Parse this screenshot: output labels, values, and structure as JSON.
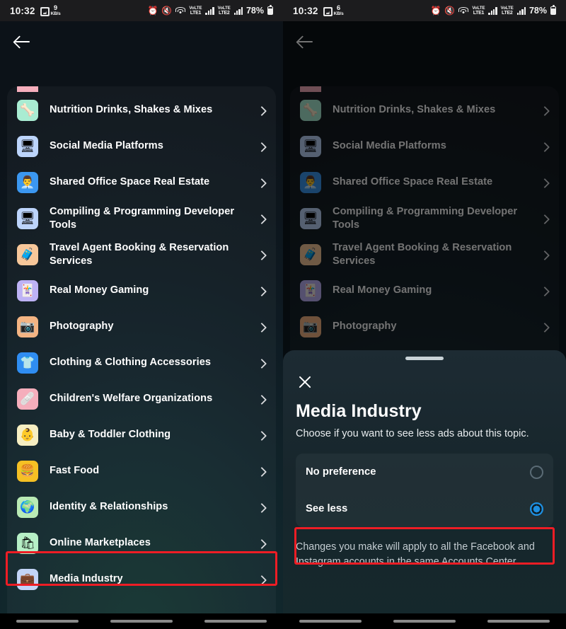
{
  "status_bar": {
    "time": "10:32",
    "left_icons": [
      "image-icon"
    ],
    "net_speed_left": {
      "value": "9",
      "unit": "KB/s"
    },
    "net_speed_right": {
      "value": "6",
      "unit": "KB/s"
    },
    "alarm_icon": "alarm-icon",
    "mute_icon": "volume-mute-icon",
    "wifi_icon": "wifi-icon",
    "sim1_label_top": "VoLTE",
    "sim1_label": "LTE1",
    "sim2_label_top": "VoLTE",
    "sim2_label": "LTE2",
    "battery_percent": "78%"
  },
  "app": {
    "back_label": "Back",
    "list_items": [
      {
        "label": "Nutrition Drinks, Shakes & Mixes",
        "icon": "nutrition-drink-icon",
        "glyph": "🦴",
        "tile": "tile-mint"
      },
      {
        "label": "Social Media Platforms",
        "icon": "social-media-icon",
        "glyph": "🖥",
        "tile": "tile-lav"
      },
      {
        "label": "Shared Office Space Real Estate",
        "icon": "shared-office-icon",
        "glyph": "👨‍💼",
        "tile": "tile-blue"
      },
      {
        "label": "Compiling & Programming Developer Tools",
        "icon": "developer-tools-icon",
        "glyph": "🖥",
        "tile": "tile-lav"
      },
      {
        "label": "Travel Agent Booking & Reservation Services",
        "icon": "travel-booking-icon",
        "glyph": "🧳",
        "tile": "tile-peach"
      },
      {
        "label": "Real Money Gaming",
        "icon": "real-money-gaming-icon",
        "glyph": "🃏",
        "tile": "tile-violet"
      },
      {
        "label": "Photography",
        "icon": "photography-icon",
        "glyph": "📷",
        "tile": "tile-orange"
      },
      {
        "label": "Clothing & Clothing Accessories",
        "icon": "clothing-icon",
        "glyph": "👕",
        "tile": "tile-dodger"
      },
      {
        "label": "Children's Welfare Organizations",
        "icon": "childrens-welfare-icon",
        "glyph": "🩹",
        "tile": "tile-pink"
      },
      {
        "label": "Baby & Toddler Clothing",
        "icon": "baby-clothing-icon",
        "glyph": "👶",
        "tile": "tile-cream"
      },
      {
        "label": "Fast Food",
        "icon": "fast-food-icon",
        "glyph": "🍔",
        "tile": "tile-gold"
      },
      {
        "label": "Identity & Relationships",
        "icon": "identity-relationships-icon",
        "glyph": "🌍",
        "tile": "tile-green"
      },
      {
        "label": "Online Marketplaces",
        "icon": "online-marketplaces-icon",
        "glyph": "🛍",
        "tile": "tile-mintlt"
      },
      {
        "label": "Media Industry",
        "icon": "media-industry-icon",
        "glyph": "💼",
        "tile": "tile-periw"
      }
    ]
  },
  "sheet": {
    "close_label": "Close",
    "title": "Media Industry",
    "subtitle": "Choose if you want to see less ads about this topic.",
    "options": [
      {
        "label": "No preference",
        "selected": false
      },
      {
        "label": "See less",
        "selected": true
      }
    ],
    "footer": "Changes you make will apply to all the Facebook and Instagram accounts in the same Accounts Center."
  },
  "annotations": {
    "highlight_color": "#ee1d25",
    "accent_color": "#1e8fe0"
  }
}
